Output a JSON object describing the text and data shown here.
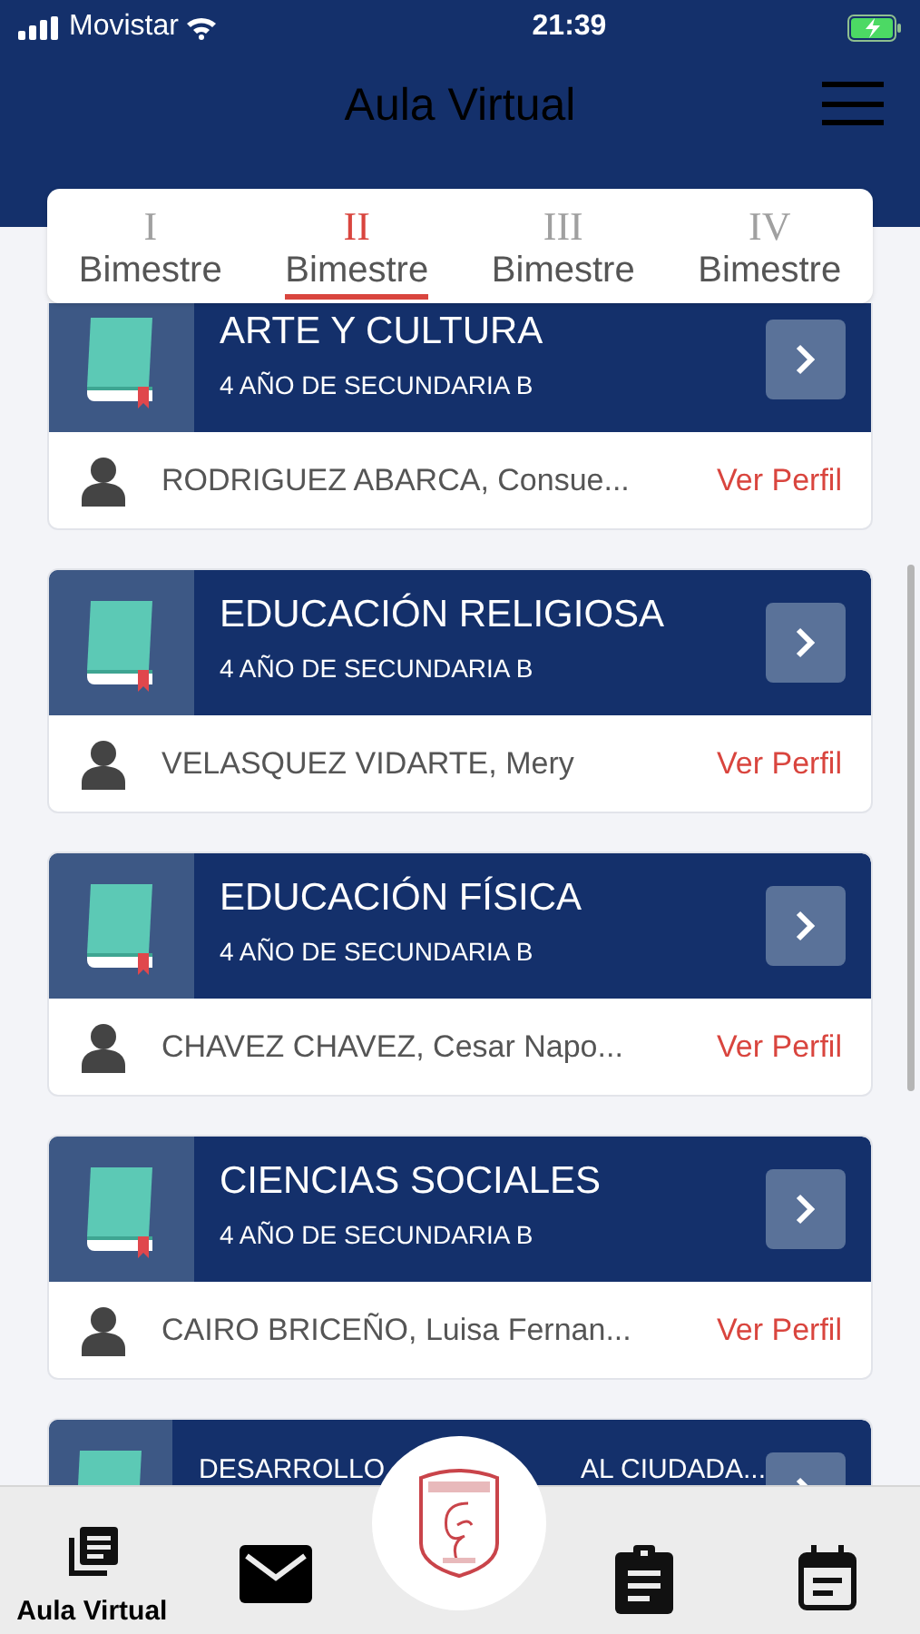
{
  "status_bar": {
    "carrier": "Movistar",
    "time": "21:39"
  },
  "header": {
    "title": "Aula Virtual"
  },
  "tabs": [
    {
      "numeral": "I",
      "label": "Bimestre",
      "selected": false
    },
    {
      "numeral": "II",
      "label": "Bimestre",
      "selected": true
    },
    {
      "numeral": "III",
      "label": "Bimestre",
      "selected": false
    },
    {
      "numeral": "IV",
      "label": "Bimestre",
      "selected": false
    }
  ],
  "courses": [
    {
      "title": "ARTE Y CULTURA",
      "grade": "4 AÑO DE SECUNDARIA B",
      "teacher": "RODRIGUEZ ABARCA, Consue...",
      "link": "Ver Perfil"
    },
    {
      "title": "EDUCACIÓN RELIGIOSA",
      "grade": "4 AÑO DE SECUNDARIA B",
      "teacher": "VELASQUEZ VIDARTE, Mery",
      "link": "Ver Perfil"
    },
    {
      "title": "EDUCACIÓN FÍSICA",
      "grade": "4 AÑO DE SECUNDARIA B",
      "teacher": "CHAVEZ CHAVEZ, Cesar Napo...",
      "link": "Ver Perfil"
    },
    {
      "title": "CIENCIAS SOCIALES",
      "grade": "4 AÑO DE SECUNDARIA B",
      "teacher": "CAIRO BRICEÑO, Luisa Fernan...",
      "link": "Ver Perfil"
    },
    {
      "title_parts": [
        "DESARROLLO",
        "AL CIUDADA..."
      ]
    }
  ],
  "bottom_nav": [
    {
      "kind": "courses",
      "label": "Aula Virtual",
      "selected": true
    },
    {
      "kind": "mail",
      "selected": false
    },
    {
      "kind": "logo"
    },
    {
      "kind": "tasks",
      "selected": false
    },
    {
      "kind": "calendar",
      "selected": false
    }
  ]
}
